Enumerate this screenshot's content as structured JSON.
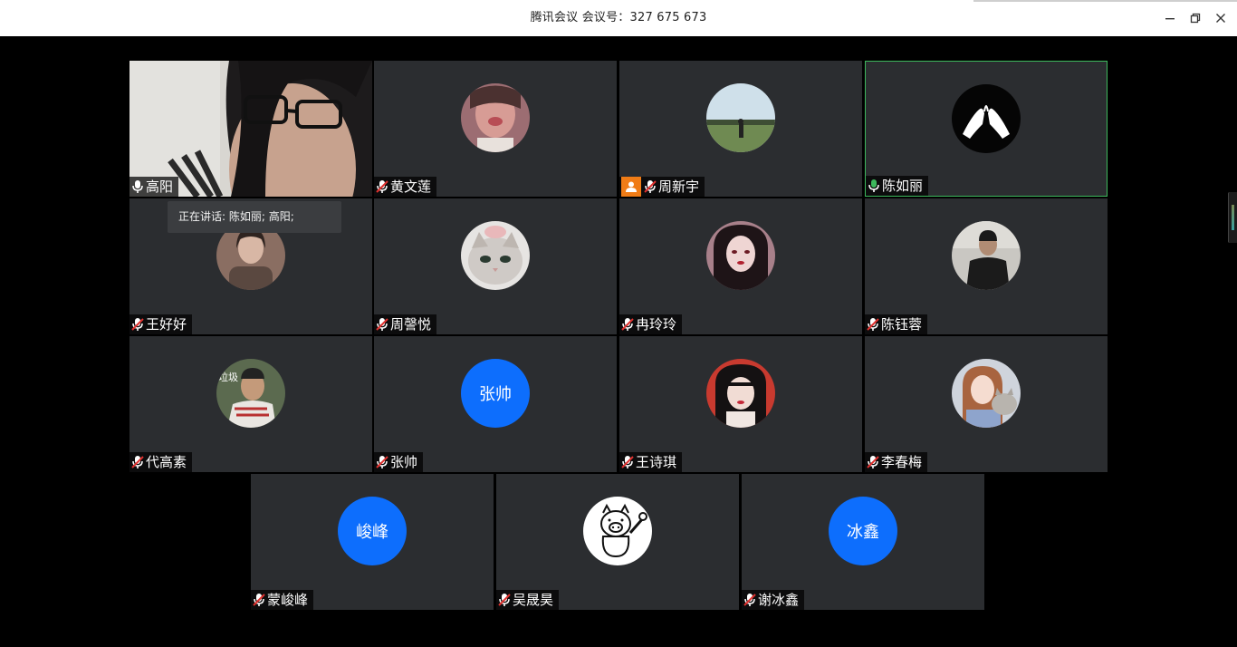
{
  "window": {
    "title": "腾讯会议 会议号：327 675 673"
  },
  "speaking_tooltip": "正在讲话: 陈如丽; 高阳;",
  "colors": {
    "tile_bg": "#2b2d30",
    "avatar_blue": "#0d6efd",
    "active_border": "#3db85c",
    "host_badge": "#f07c16",
    "mic_muted": "#e0312f",
    "mic_active": "#3db85c"
  },
  "participants": [
    {
      "name": "高阳",
      "mic": "on",
      "video": true
    },
    {
      "name": "黄文莲",
      "mic": "muted",
      "avatar": "photo-avatar"
    },
    {
      "name": "周新宇",
      "mic": "muted",
      "host": true,
      "avatar": "photo-avatar"
    },
    {
      "name": "陈如丽",
      "mic": "speaking",
      "active": true,
      "avatar": "photo-avatar"
    },
    {
      "name": "王好好",
      "mic": "muted",
      "avatar": "photo-avatar"
    },
    {
      "name": "周謦悦",
      "mic": "muted",
      "avatar": "photo-avatar"
    },
    {
      "name": "冉玲玲",
      "mic": "muted",
      "avatar": "photo-avatar"
    },
    {
      "name": "陈钰蓉",
      "mic": "muted",
      "avatar": "photo-avatar"
    },
    {
      "name": "代高素",
      "mic": "muted",
      "avatar": "photo-avatar",
      "avatar_caption": "垃圾"
    },
    {
      "name": "张帅",
      "mic": "muted",
      "avatar_text": "张帅"
    },
    {
      "name": "王诗琪",
      "mic": "muted",
      "avatar": "photo-avatar"
    },
    {
      "name": "李春梅",
      "mic": "muted",
      "avatar": "photo-avatar"
    },
    {
      "name": "蒙峻峰",
      "mic": "muted",
      "avatar_text": "峻峰"
    },
    {
      "name": "吴晟昊",
      "mic": "muted",
      "avatar": "photo-avatar"
    },
    {
      "name": "谢冰鑫",
      "mic": "muted",
      "avatar_text": "冰鑫"
    }
  ]
}
